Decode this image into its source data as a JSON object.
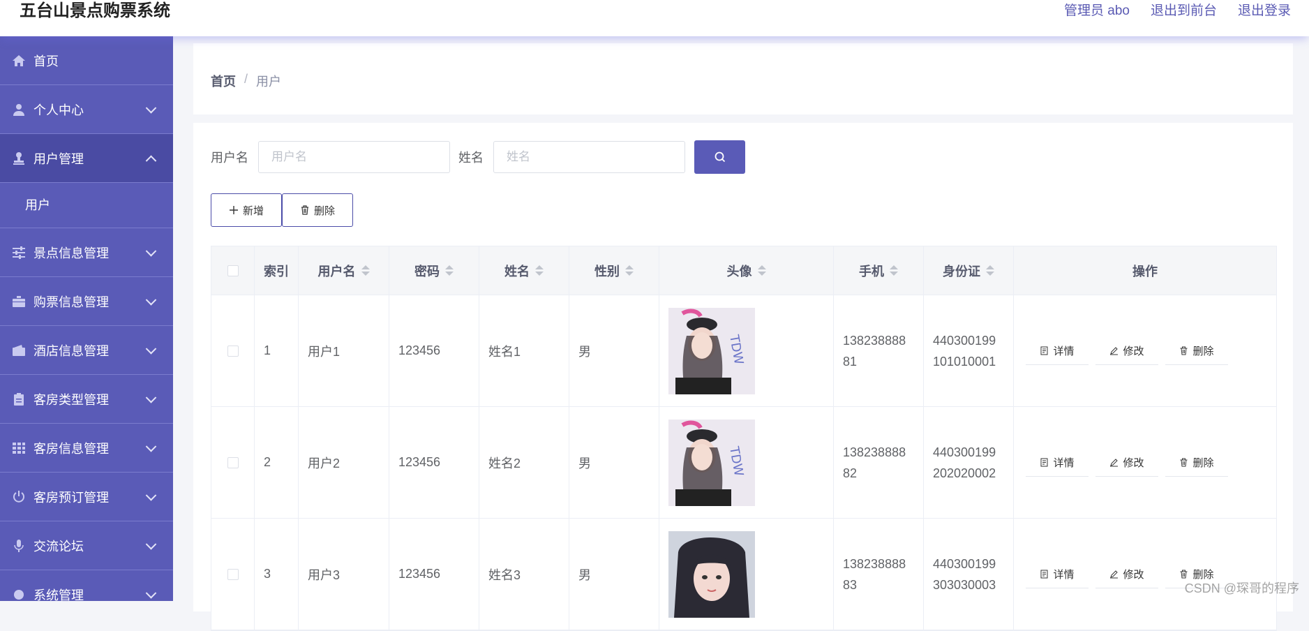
{
  "header": {
    "title": "五台山景点购票系统",
    "admin_label": "管理员 abo",
    "front_label": "退出到前台",
    "logout_label": "退出登录"
  },
  "sidebar": {
    "items": [
      {
        "label": "首页",
        "icon": "home-icon"
      },
      {
        "label": "个人中心",
        "icon": "user-icon"
      },
      {
        "label": "用户管理",
        "icon": "stamp-icon",
        "expanded": true,
        "sub": "用户"
      },
      {
        "label": "景点信息管理",
        "icon": "sliders-icon"
      },
      {
        "label": "购票信息管理",
        "icon": "briefcase-icon"
      },
      {
        "label": "酒店信息管理",
        "icon": "wallet-icon"
      },
      {
        "label": "客房类型管理",
        "icon": "clipboard-icon"
      },
      {
        "label": "客房信息管理",
        "icon": "grid-icon"
      },
      {
        "label": "客房预订管理",
        "icon": "power-icon"
      },
      {
        "label": "交流论坛",
        "icon": "mic-icon"
      },
      {
        "label": "系统管理",
        "icon": "settings-icon"
      }
    ]
  },
  "breadcrumb": {
    "home": "首页",
    "sep": "/",
    "current": "用户"
  },
  "search": {
    "username_label": "用户名",
    "username_placeholder": "用户名",
    "name_label": "姓名",
    "name_placeholder": "姓名"
  },
  "actions": {
    "add": "新增",
    "delete": "删除"
  },
  "table": {
    "headers": [
      "索引",
      "用户名",
      "密码",
      "姓名",
      "性别",
      "头像",
      "手机",
      "身份证",
      "操作"
    ],
    "rows": [
      {
        "index": "1",
        "username": "用户1",
        "password": "123456",
        "name": "姓名1",
        "gender": "男",
        "phone1": "138238888",
        "phone2": "81",
        "id1": "440300199",
        "id2": "101010001"
      },
      {
        "index": "2",
        "username": "用户2",
        "password": "123456",
        "name": "姓名2",
        "gender": "男",
        "phone1": "138238888",
        "phone2": "82",
        "id1": "440300199",
        "id2": "202020002"
      },
      {
        "index": "3",
        "username": "用户3",
        "password": "123456",
        "name": "姓名3",
        "gender": "男",
        "phone1": "138238888",
        "phone2": "83",
        "id1": "440300199",
        "id2": "303030003"
      }
    ],
    "ops": {
      "detail": "详情",
      "edit": "修改",
      "delete": "删除"
    }
  },
  "watermark": "CSDN @琛哥的程序",
  "colors": {
    "accent": "#5a5bb7",
    "accent_dark": "#4a4ba3",
    "link": "#5a5ab3"
  }
}
